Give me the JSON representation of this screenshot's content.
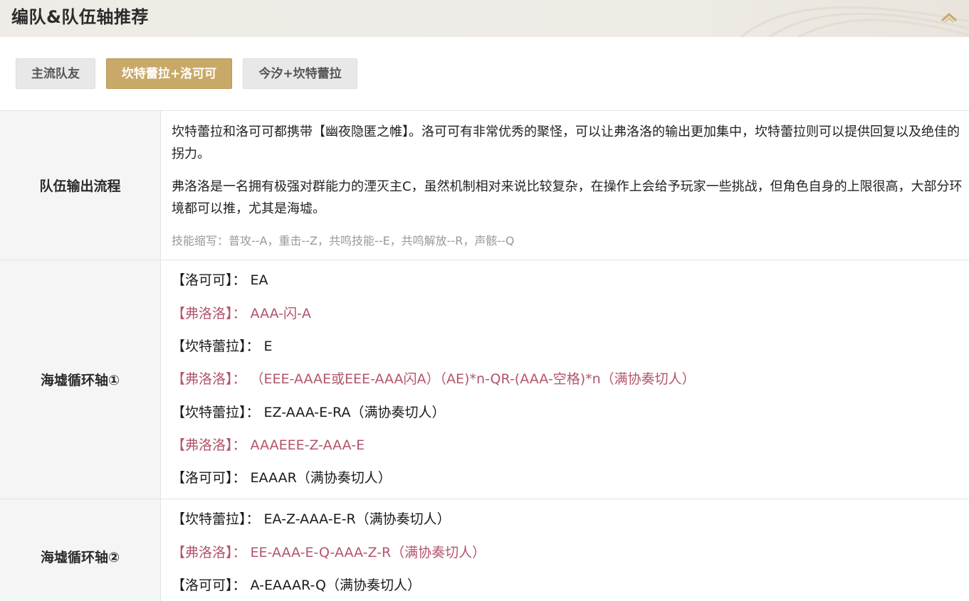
{
  "header": {
    "title": "编队&队伍轴推荐"
  },
  "tabs": [
    {
      "label": "主流队友",
      "active": false
    },
    {
      "label": "坎特蕾拉+洛可可",
      "active": true
    },
    {
      "label": "今汐+坎特蕾拉",
      "active": false
    }
  ],
  "colors": {
    "accent": "#c9a968",
    "highlight_text": "#b3546a",
    "note_text": "#999999"
  },
  "rows": [
    {
      "label": "队伍输出流程",
      "paragraphs": [
        "坎特蕾拉和洛可可都携带【幽夜隐匿之帷】。洛可可有非常优秀的聚怪，可以让弗洛洛的输出更加集中，坎特蕾拉则可以提供回复以及绝佳的拐力。",
        "弗洛洛是一名拥有极强对群能力的湮灭主C，虽然机制相对来说比较复杂，在操作上会给予玩家一些挑战，但角色自身的上限很高，大部分环境都可以推，尤其是海墟。"
      ],
      "note": "技能缩写：普攻--A，重击--Z，共鸣技能--E，共鸣解放--R，声骸--Q"
    },
    {
      "label": "海墟循环轴①",
      "lines": [
        {
          "text": "【洛可可】：  EA",
          "style": "black"
        },
        {
          "text": "【弗洛洛】：  AAA-闪-A",
          "style": "pink"
        },
        {
          "text": "【坎特蕾拉】：  E",
          "style": "black"
        },
        {
          "text": "【弗洛洛】：  （EEE-AAAE或EEE-AAA闪A）（AE)*n-QR-(AAA-空格)*n（满协奏切人）",
          "style": "pink"
        },
        {
          "text": "【坎特蕾拉】：  EZ-AAA-E-RA（满协奏切人）",
          "style": "black"
        },
        {
          "text": "【弗洛洛】：  AAAEEE-Z-AAA-E",
          "style": "pink"
        },
        {
          "text": "【洛可可】：  EAAAR（满协奏切人）",
          "style": "black"
        }
      ]
    },
    {
      "label": "海墟循环轴②",
      "lines": [
        {
          "text": "【坎特蕾拉】：  EA-Z-AAA-E-R（满协奏切人）",
          "style": "black"
        },
        {
          "text": "【弗洛洛】：  EE-AAA-E-Q-AAA-Z-R（满协奏切人）",
          "style": "pink"
        },
        {
          "text": "【洛可可】：  A-EAAAR-Q（满协奏切人）",
          "style": "black"
        }
      ]
    }
  ]
}
